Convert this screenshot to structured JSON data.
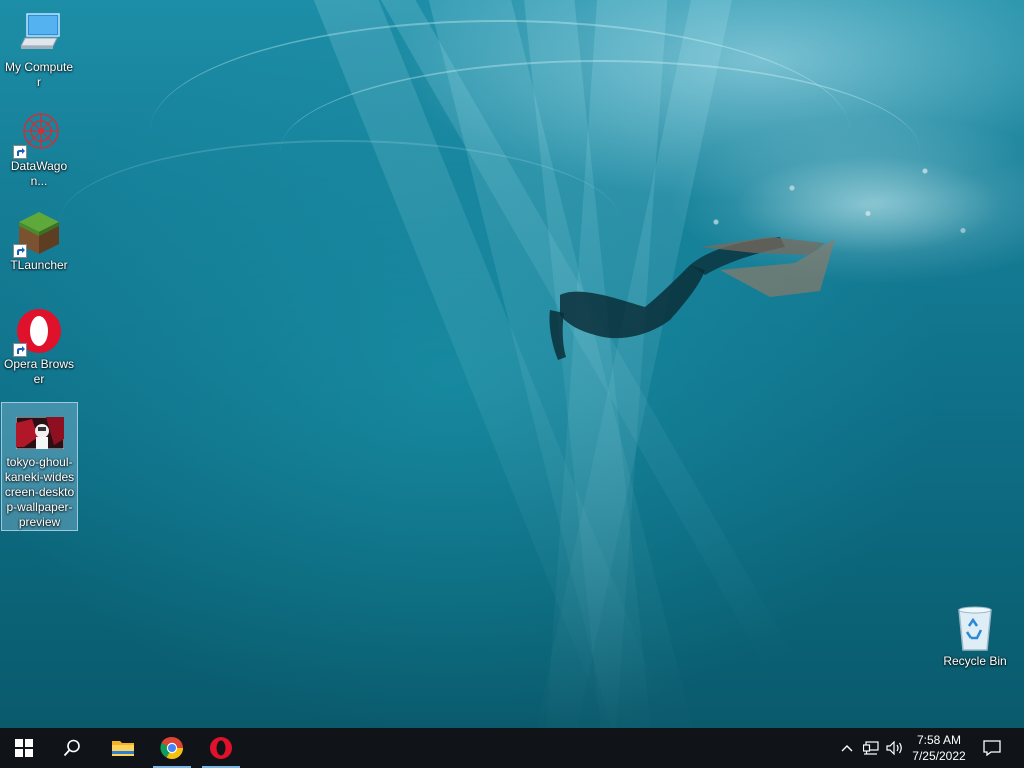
{
  "desktop": {
    "icons": [
      {
        "label": "My Computer",
        "icon": "computer-icon"
      },
      {
        "label": "DataWagon...",
        "icon": "datawagon-icon"
      },
      {
        "label": "TLauncher",
        "icon": "tlauncher-icon"
      },
      {
        "label": "Opera Browser",
        "icon": "opera-icon"
      },
      {
        "label": "tokyo-ghoul-kaneki-widescreen-desktop-wallpaper-preview",
        "icon": "image-file-icon",
        "selected": true
      },
      {
        "label": "Recycle Bin",
        "icon": "recycle-bin-icon"
      }
    ]
  },
  "taskbar": {
    "pinned": [
      {
        "name": "start",
        "icon": "windows-logo-icon"
      },
      {
        "name": "search",
        "icon": "search-icon"
      },
      {
        "name": "file-explorer",
        "icon": "folder-icon"
      },
      {
        "name": "chrome",
        "icon": "chrome-icon",
        "running": true
      },
      {
        "name": "opera",
        "icon": "opera-icon",
        "running": true
      }
    ],
    "tray": {
      "time": "7:58 AM",
      "date": "7/25/2022"
    }
  },
  "colors": {
    "taskbar": "#101418",
    "accent": "#7ab6e6",
    "opera_red": "#e0112b"
  }
}
